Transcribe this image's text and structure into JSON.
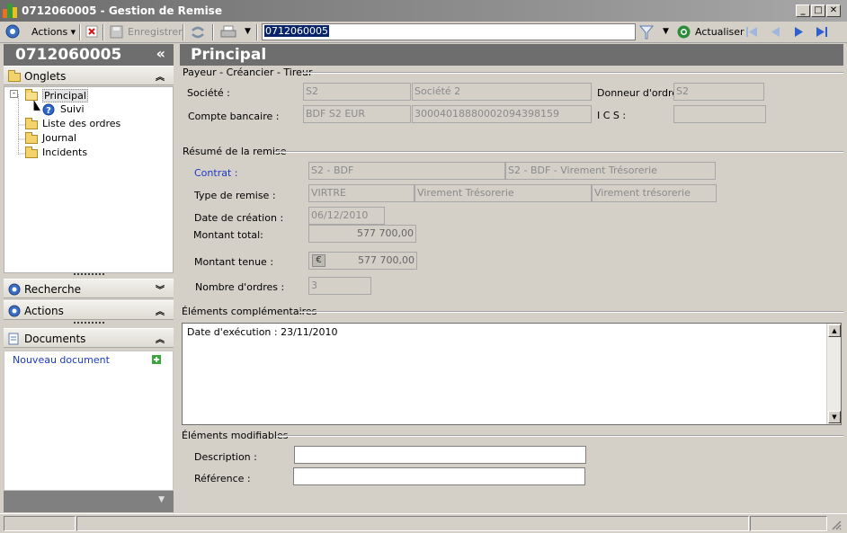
{
  "window": {
    "title": "0712060005 -  Gestion de Remise",
    "controls": [
      "minimize",
      "maximize",
      "close"
    ]
  },
  "toolbar": {
    "actions_label": "Actions",
    "save_label": "Enregistrer",
    "record_value": "0712060005",
    "refresh_label": "Actualiser"
  },
  "sidebar": {
    "record_title": "0712060005",
    "collapse_glyph": "«",
    "onglets_title": "Onglets",
    "tree": [
      {
        "label": "Principal",
        "icon": "folder-open-icon",
        "selected": true
      },
      {
        "label": "Suivi",
        "icon": "help-icon"
      },
      {
        "label": "Liste des ordres",
        "icon": "folder-icon"
      },
      {
        "label": "Journal",
        "icon": "folder-icon"
      },
      {
        "label": "Incidents",
        "icon": "folder-icon"
      }
    ],
    "recherche_title": "Recherche",
    "actions_title": "Actions",
    "documents_title": "Documents",
    "new_document_label": "Nouveau document"
  },
  "main": {
    "title": "Principal",
    "payeur": {
      "section_title": "Payeur - Créancier - Tireur",
      "societe_label": "Société  :",
      "societe_code": "S2",
      "societe_name": "Société 2",
      "donneur_label": "Donneur d'ordre :",
      "donneur_value": "S2",
      "compte_label": "Compte bancaire  :",
      "compte_code": "BDF S2 EUR",
      "compte_number": "30004018880002094398159",
      "ics_label": "I C S :",
      "ics_value": ""
    },
    "resume": {
      "section_title": "Résumé de la remise",
      "contrat_label": "Contrat :",
      "contrat_code": "S2 - BDF",
      "contrat_name": "S2 - BDF - Virement Trésorerie",
      "type_label": "Type de remise :",
      "type_code": "VIRTRE",
      "type_name": "Virement Trésorerie",
      "type_name2": "Virement trésorerie",
      "date_label": "Date de création :",
      "date_value": "06/12/2010",
      "montant_total_label": "Montant total:",
      "montant_total_value": "577 700,00",
      "montant_tenue_label": "Montant tenue :",
      "montant_tenue_value": "577 700,00",
      "currency_symbol": "€",
      "nombre_label": "Nombre d'ordres :",
      "nombre_value": "3"
    },
    "complementaires": {
      "section_title": "Éléments complémentaires",
      "text": "Date d'exécution : 23/11/2010"
    },
    "modifiables": {
      "section_title": "Éléments modifiables",
      "description_label": "Description :",
      "description_value": "",
      "reference_label": "Référence :",
      "reference_value": ""
    }
  },
  "colors": {
    "header_bg": "#6e6e6e",
    "link": "#1b39c3",
    "selection": "#0a246a"
  }
}
